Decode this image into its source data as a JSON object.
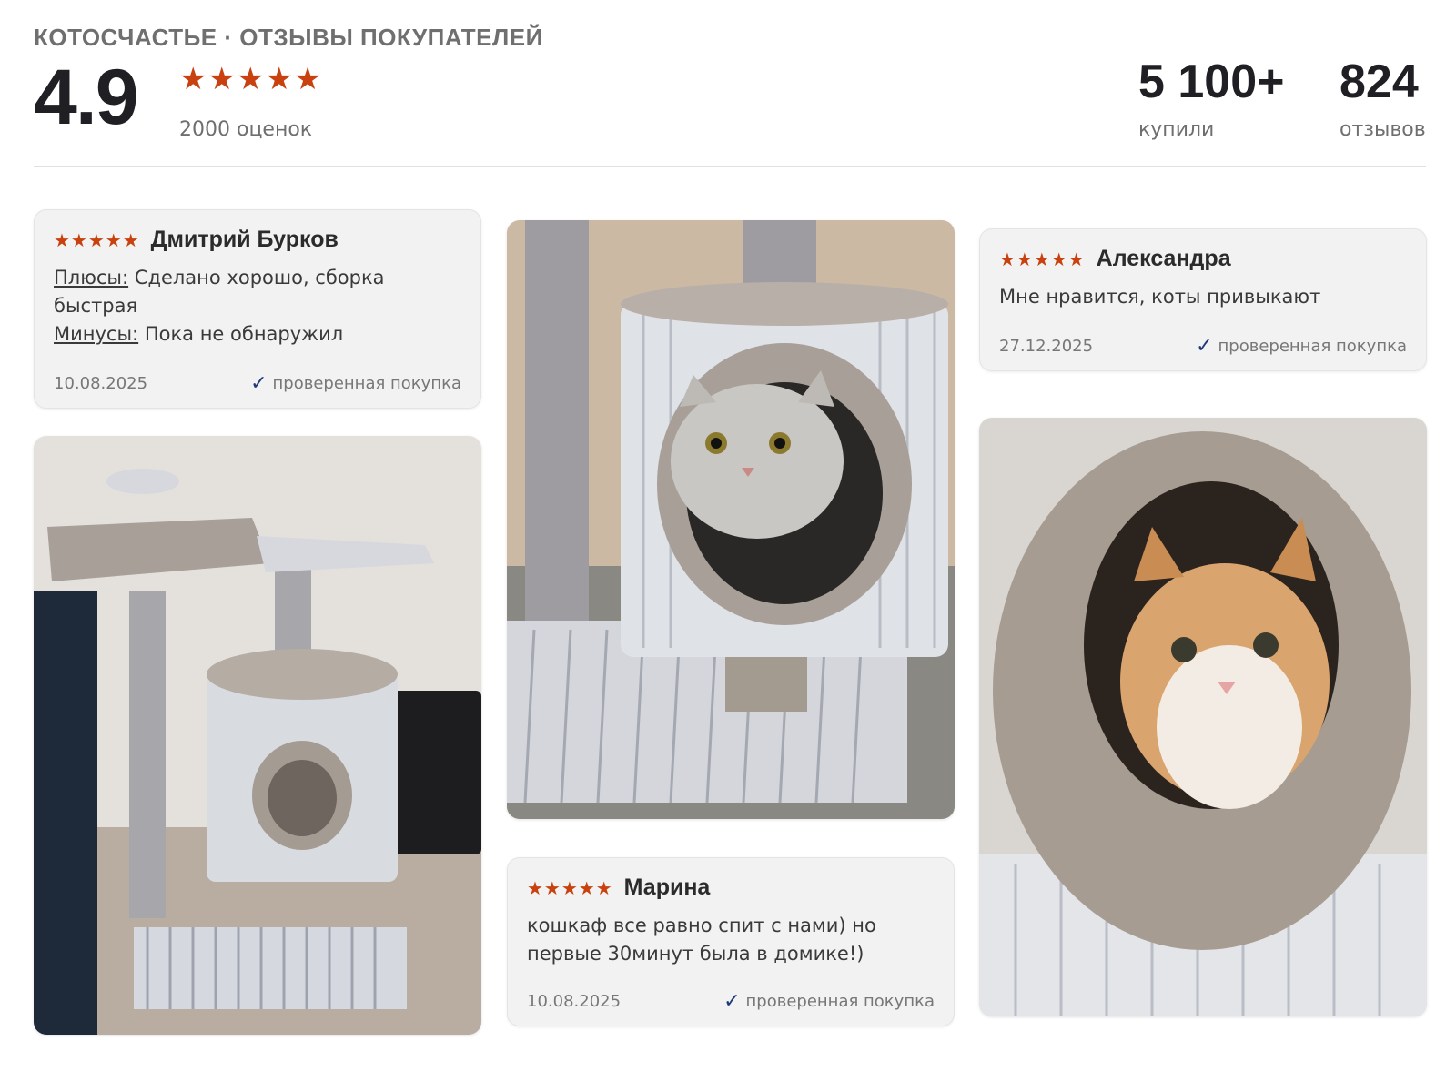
{
  "header": {
    "brand": "КОТОСЧАСТЬЕ · ОТЗЫВЫ ПОКУПАТЕЛЕЙ",
    "rating": "4.9",
    "rating_stars": "★★★★★",
    "rating_count": "2000 оценок",
    "bought_value": "5 100+",
    "bought_label": "купили",
    "reviews_value": "824",
    "reviews_label": "отзывов"
  },
  "reviews": [
    {
      "stars": "★★★★★",
      "author": "Дмитрий Бурков",
      "pros_label": "Плюсы:",
      "pros": "Сделано хорошо, сборка быстрая",
      "cons_label": "Минусы:",
      "cons": "Пока не обнаружил",
      "date": "10.08.2025",
      "verified": "проверенная покупка"
    },
    {
      "stars": "★★★★★",
      "author": "Марина",
      "text": "кошкаф все равно спит с нами) но первые 30минут была в домике!)",
      "date": "10.08.2025",
      "verified": "проверенная покупка"
    },
    {
      "stars": "★★★★★",
      "author": "Александра",
      "text": "Мне нравится, коты привыкают",
      "date": "27.12.2025",
      "verified": "проверенная покупка"
    }
  ],
  "icons": {
    "star": "star-icon",
    "verified": "checkmark-icon"
  },
  "colors": {
    "star": "#c8410f",
    "verified_check": "#1f3a7a",
    "card_bg": "#f2f2f2"
  }
}
